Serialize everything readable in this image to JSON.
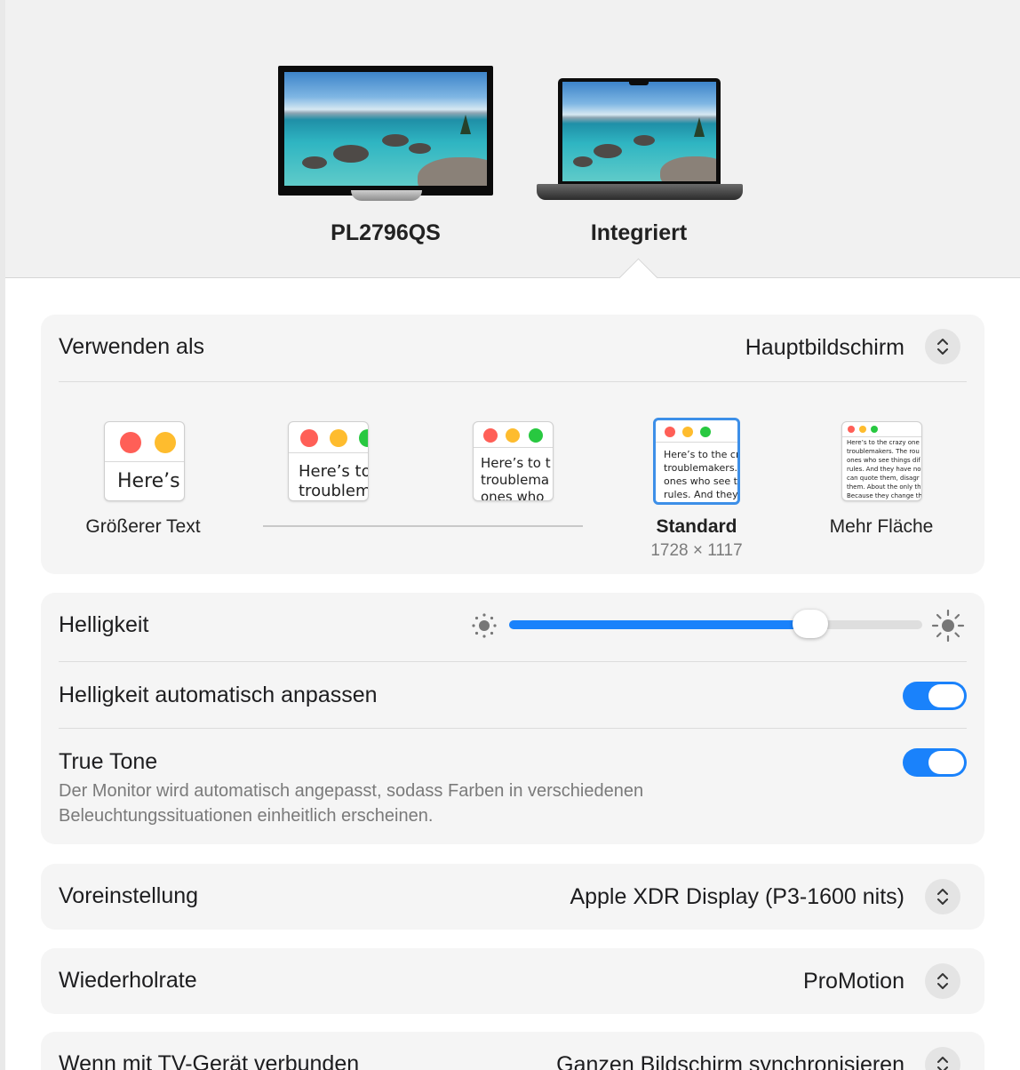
{
  "displays": [
    {
      "name": "PL2796QS"
    },
    {
      "name": "Integriert"
    }
  ],
  "use_as": {
    "label": "Verwenden als",
    "value": "Hauptbildschirm"
  },
  "resolution": {
    "options": [
      {
        "label": "Größerer Text",
        "preview_text": "Here’s"
      },
      {
        "label": "",
        "preview_text": "Here’s to\ntroublem"
      },
      {
        "label": "",
        "preview_text": "Here’s to t\ntroublema\nones who"
      },
      {
        "label": "Standard",
        "sublabel": "1728 × 1117",
        "preview_text": "Here’s to the cr\ntroublemakers.\nones who see t\nrules. And they"
      },
      {
        "label": "Mehr Fläche",
        "preview_text": "Here’s to the crazy one\ntroublemakers. The rou\nones who see things dif\nrules. And they have no\ncan quote them, disagr\nthem. About the only th\nBecause they change th"
      }
    ],
    "selected_index": 3
  },
  "brightness": {
    "label": "Helligkeit",
    "value_fraction": 0.73
  },
  "auto_brightness": {
    "label": "Helligkeit automatisch anpassen",
    "enabled": true
  },
  "true_tone": {
    "label": "True Tone",
    "enabled": true,
    "description_line1": "Der Monitor wird automatisch angepasst, sodass Farben in verschiedenen",
    "description_line2": "Beleuchtungssituationen einheitlich erscheinen."
  },
  "preset": {
    "label": "Voreinstellung",
    "value": "Apple XDR Display (P3-1600 nits)"
  },
  "refresh_rate": {
    "label": "Wiederholrate",
    "value": "ProMotion"
  },
  "tv_connected": {
    "label": "Wenn mit TV-Gerät verbunden",
    "value": "Ganzen Bildschirm synchronisieren"
  },
  "colors": {
    "accent": "#1a82fb",
    "selection_border": "#3d8fe8",
    "card_bg": "#f5f5f5"
  }
}
